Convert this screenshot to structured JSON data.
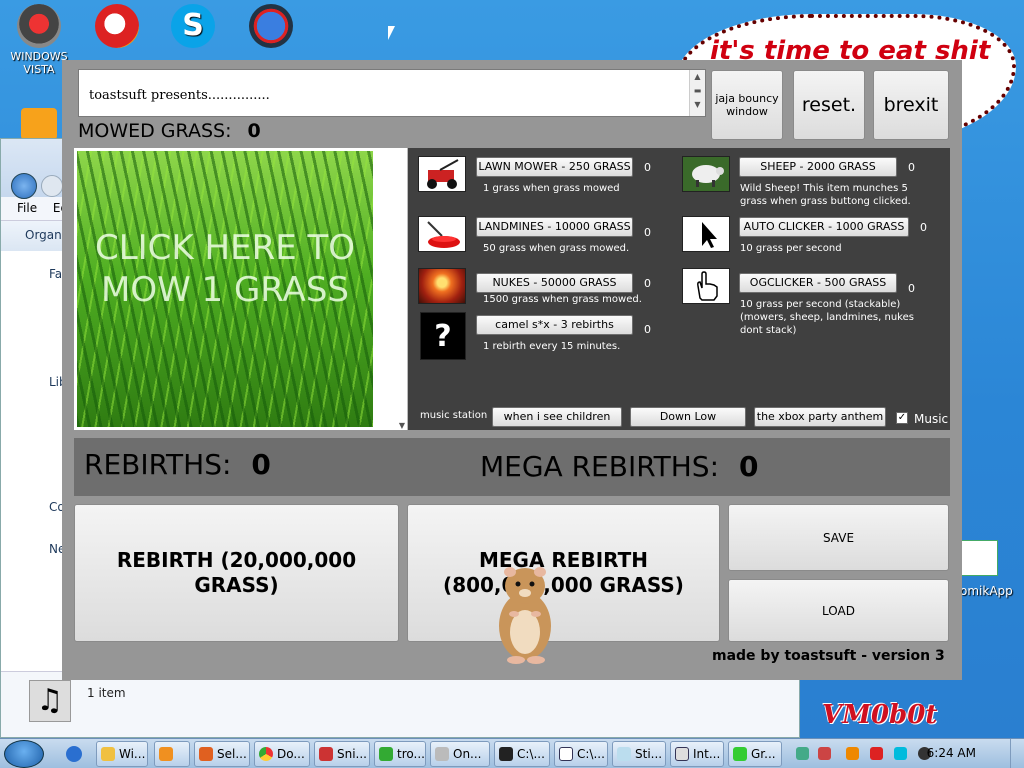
{
  "desktop": {
    "icons": [
      {
        "label": "WINDOWS VISTA"
      },
      {
        "label": ""
      },
      {
        "label": ""
      },
      {
        "label": ""
      }
    ],
    "banner_text": "it's time to eat shit",
    "comik_label": "omikApp",
    "vm_label": "VM0b0t"
  },
  "explorer": {
    "menu": [
      "File",
      "Ed"
    ],
    "organize": "Organi",
    "sidebar": [
      "Fa",
      "Lib",
      "Co",
      "Ne"
    ],
    "status": "1 item"
  },
  "game": {
    "text_box": "toastsuft presents...............",
    "buttons": {
      "jaja": "jaja bouncy window",
      "reset": "reset.",
      "brexit": "brexit",
      "rebirth": "REBIRTH (20,000,000 GRASS)",
      "mega_rebirth": "MEGA REBIRTH (800,000,000 GRASS)",
      "save": "SAVE",
      "load": "LOAD"
    },
    "mowed_label": "MOWED GRASS:",
    "mowed_value": "0",
    "click_text": "CLICK HERE TO MOW 1 GRASS",
    "shop": [
      {
        "button": "LAWN MOWER - 250 GRASS",
        "count": "0",
        "desc": "1 grass when grass mowed",
        "icon": "lawn-mower"
      },
      {
        "button": "SHEEP - 2000 GRASS",
        "count": "0",
        "desc": "Wild Sheep! This item munches 5 grass when grass buttong clicked.",
        "icon": "sheep"
      },
      {
        "button": "LANDMINES - 10000 GRASS",
        "count": "0",
        "desc": "50 grass when grass mowed.",
        "icon": "landmine"
      },
      {
        "button": "AUTO CLICKER - 1000 GRASS",
        "count": "0",
        "desc": "10 grass per second",
        "icon": "cursor-arrow"
      },
      {
        "button": "NUKES - 50000 GRASS",
        "count": "0",
        "desc": "1500 grass when grass mowed.",
        "icon": "nuke-explosion"
      },
      {
        "button": "OGCLICKER - 500 GRASS",
        "count": "0",
        "desc": "10 grass per second (stackable) (mowers, sheep, landmines, nukes dont stack)",
        "icon": "hand-cursor"
      },
      {
        "button": "camel s*x - 3 rebirths",
        "count": "0",
        "desc": "1 rebirth every 15 minutes.",
        "icon": "question-mark"
      }
    ],
    "music": {
      "label": "music station",
      "tracks": [
        "when i see children",
        "Down Low",
        "the xbox party anthem"
      ],
      "checkbox_label": "Music",
      "checked": true
    },
    "rebirths_label": "REBIRTHS:",
    "rebirths_value": "0",
    "mega_rebirths_label": "MEGA REBIRTHS:",
    "mega_rebirths_value": "0",
    "credit": "made by toastsuft - version 3"
  },
  "taskbar": {
    "tasks": [
      "Wi...",
      "",
      "Sel...",
      "Do...",
      "Sni...",
      "tro...",
      "On...",
      "C:\\...",
      "C:\\...",
      "Sti...",
      "Int...",
      "Gr..."
    ],
    "clock": "6:24 AM"
  }
}
